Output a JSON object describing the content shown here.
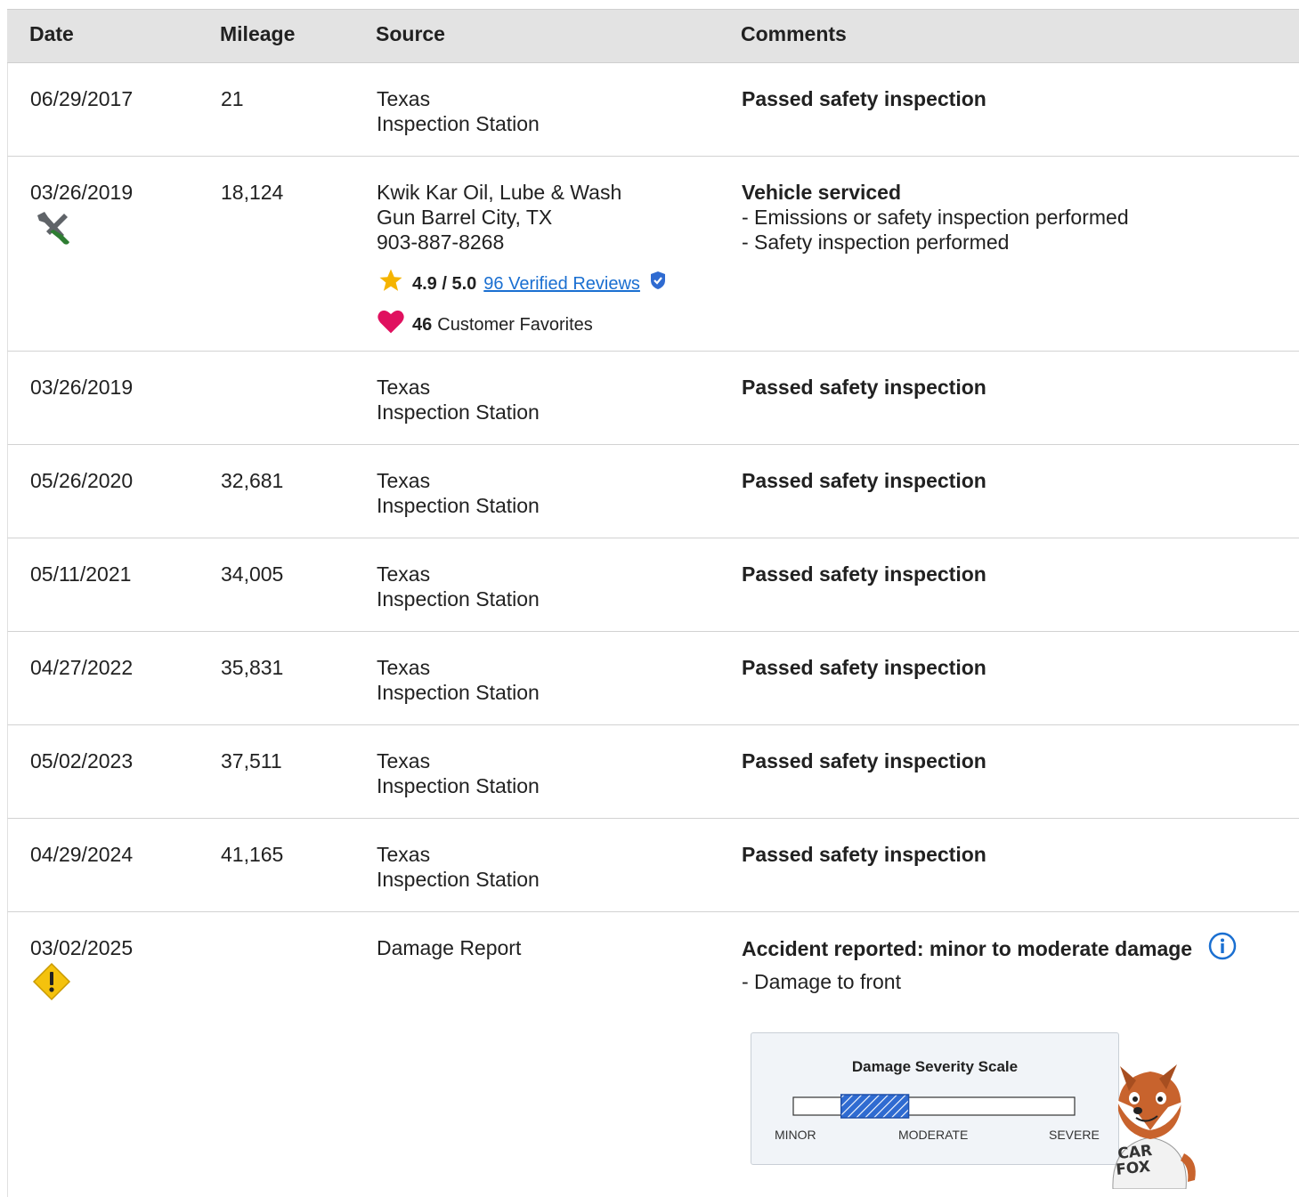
{
  "columns": {
    "date": "Date",
    "mileage": "Mileage",
    "source": "Source",
    "comments": "Comments"
  },
  "rows": [
    {
      "date": "06/29/2017",
      "mileage": "21",
      "source": [
        "Texas",
        "Inspection Station"
      ],
      "comment_title": "Passed safety inspection"
    },
    {
      "date": "03/26/2019",
      "mileage": "18,124",
      "source": [
        "Kwik Kar Oil, Lube & Wash",
        "Gun Barrel City, TX",
        "903-887-8268"
      ],
      "comment_title": "Vehicle serviced",
      "comment_items": [
        "- Emissions or safety inspection performed",
        "- Safety inspection performed"
      ],
      "rating": "4.9 / 5.0",
      "reviews_link": "96 Verified Reviews",
      "favorites_count": "46",
      "favorites_label": "Customer Favorites",
      "icon": "wrench-screwdriver-icon"
    },
    {
      "date": "03/26/2019",
      "mileage": "",
      "source": [
        "Texas",
        "Inspection Station"
      ],
      "comment_title": "Passed safety inspection"
    },
    {
      "date": "05/26/2020",
      "mileage": "32,681",
      "source": [
        "Texas",
        "Inspection Station"
      ],
      "comment_title": "Passed safety inspection"
    },
    {
      "date": "05/11/2021",
      "mileage": "34,005",
      "source": [
        "Texas",
        "Inspection Station"
      ],
      "comment_title": "Passed safety inspection"
    },
    {
      "date": "04/27/2022",
      "mileage": "35,831",
      "source": [
        "Texas",
        "Inspection Station"
      ],
      "comment_title": "Passed safety inspection"
    },
    {
      "date": "05/02/2023",
      "mileage": "37,511",
      "source": [
        "Texas",
        "Inspection Station"
      ],
      "comment_title": "Passed safety inspection"
    },
    {
      "date": "04/29/2024",
      "mileage": "41,165",
      "source": [
        "Texas",
        "Inspection Station"
      ],
      "comment_title": "Passed safety inspection"
    },
    {
      "date": "03/02/2025",
      "mileage": "",
      "source": [
        "Damage Report"
      ],
      "comment_title": "Accident reported: minor to moderate damage",
      "comment_items": [
        "- Damage to front"
      ],
      "icon": "warning-diamond-icon"
    }
  ],
  "severity_scale": {
    "title": "Damage Severity Scale",
    "labels": {
      "minor": "MINOR",
      "moderate": "MODERATE",
      "severe": "SEVERE"
    },
    "highlight_range": [
      0.17,
      0.41
    ]
  },
  "mascot_text": [
    "CAR",
    "FOX"
  ],
  "colors": {
    "link": "#1a6fd1",
    "star": "#f5b400",
    "heart": "#e0115f",
    "warning": "#f4c20d",
    "info": "#1a6fd1",
    "scale_fill": "#2f6bd1"
  }
}
